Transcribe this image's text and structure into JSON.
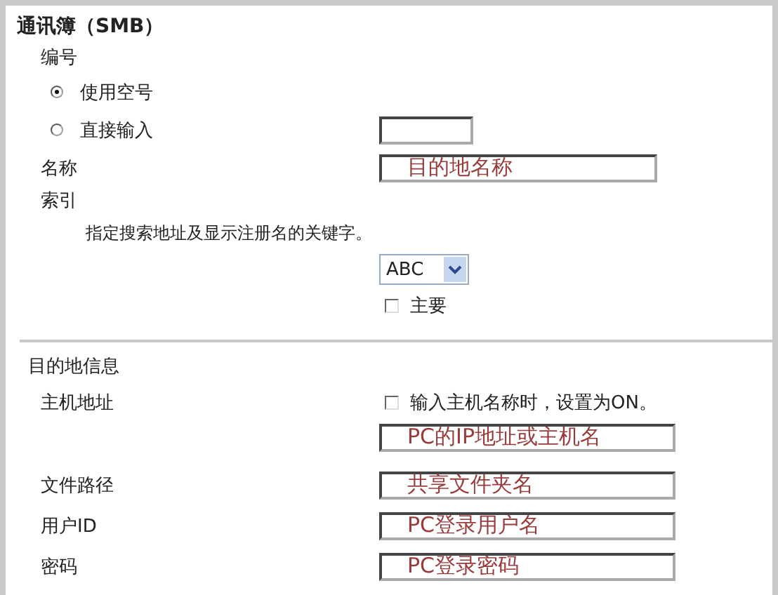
{
  "title": "通讯簿（SMB）",
  "number": {
    "label": "编号",
    "options": [
      {
        "label": "使用空号",
        "selected": true
      },
      {
        "label": "直接输入",
        "selected": false
      }
    ]
  },
  "name": {
    "label": "名称",
    "value": "目的地名称"
  },
  "index": {
    "label": "索引",
    "hint": "指定搜索地址及显示注册名的关键字。",
    "select": "ABC",
    "primary": {
      "label": "主要",
      "checked": false
    }
  },
  "destination": {
    "heading": "目的地信息",
    "host": {
      "label": "主机地址",
      "checkbox": {
        "label": "输入主机名称时，设置为ON。",
        "checked": false
      },
      "value": "PC的IP地址或主机名"
    },
    "fields": [
      {
        "label": "文件路径",
        "value": "共享文件夹名"
      },
      {
        "label": "用户ID",
        "value": "PC登录用户名"
      },
      {
        "label": "密码",
        "value": "PC登录密码"
      }
    ]
  }
}
